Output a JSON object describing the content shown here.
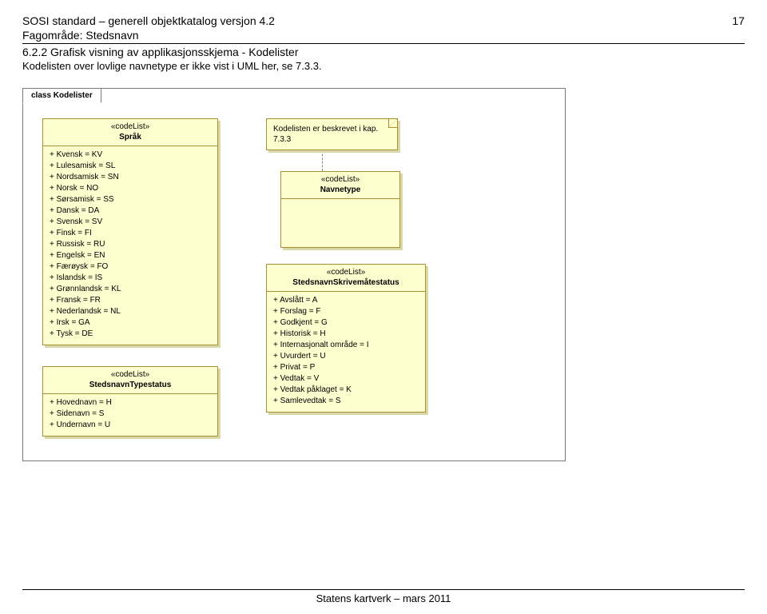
{
  "header": {
    "title_line1": "SOSI standard – generell objektkatalog versjon 4.2",
    "page_number": "17",
    "title_line2": "Fagområde: Stedsnavn",
    "section_title": "6.2.2  Grafisk visning av applikasjonsskjema - Kodelister",
    "subnote": "Kodelisten over lovlige navnetype er ikke vist i UML her, se 7.3.3."
  },
  "diagram": {
    "label": "class Kodelister",
    "note": {
      "line1": "Kodelisten er  beskrevet i kap.",
      "line2": "7.3.3"
    },
    "sprak": {
      "stereo": "«codeList»",
      "name": "Språk",
      "items": [
        "Kvensk = KV",
        "Lulesamisk = SL",
        "Nordsamisk = SN",
        "Norsk = NO",
        "Sørsamisk = SS",
        "Dansk = DA",
        "Svensk = SV",
        "Finsk = FI",
        "Russisk = RU",
        "Engelsk = EN",
        "Færøysk = FO",
        "Islandsk = IS",
        "Grønnlandsk = KL",
        "Fransk = FR",
        "Nederlandsk = NL",
        "Irsk = GA",
        "Tysk = DE"
      ]
    },
    "typestatus": {
      "stereo": "«codeList»",
      "name": "StedsnavnTypestatus",
      "items": [
        "Hovednavn = H",
        "Sidenavn = S",
        "Undernavn = U"
      ]
    },
    "navnetype": {
      "stereo": "«codeList»",
      "name": "Navnetype"
    },
    "skrivestatus": {
      "stereo": "«codeList»",
      "name": "StedsnavnSkrivemåtestatus",
      "items": [
        "Avslått = A",
        "Forslag = F",
        "Godkjent = G",
        "Historisk = H",
        "Internasjonalt område = I",
        "Uvurdert = U",
        "Privat = P",
        "Vedtak = V",
        "Vedtak påklaget = K",
        "Samlevedtak = S"
      ]
    }
  },
  "footer": "Statens kartverk – mars 2011"
}
